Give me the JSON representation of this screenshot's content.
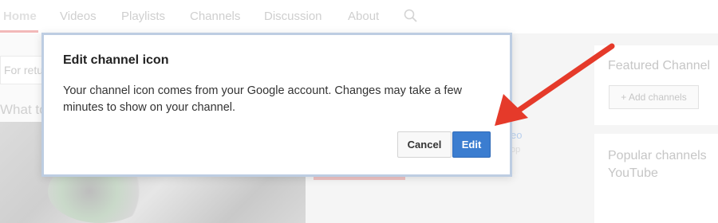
{
  "tabs": [
    {
      "label": "Home",
      "active": true
    },
    {
      "label": "Videos"
    },
    {
      "label": "Playlists"
    },
    {
      "label": "Channels"
    },
    {
      "label": "Discussion"
    },
    {
      "label": "About"
    }
  ],
  "left": {
    "input_text": "For retu",
    "heading": "What to"
  },
  "middle": {
    "link_fragment": "eo",
    "sub_fragment": "op"
  },
  "sidebar": {
    "featured_title": "Featured Channel",
    "add_channels_label": "+ Add channels",
    "popular_title_line1": "Popular channels",
    "popular_title_line2": "YouTube"
  },
  "dialog": {
    "title": "Edit channel icon",
    "body": "Your channel icon comes from your Google account. Changes may take a few minutes to show on your channel.",
    "cancel_label": "Cancel",
    "edit_label": "Edit"
  },
  "colors": {
    "edit_button": "#3b7dd0",
    "annotation_arrow": "#e53a2a",
    "dialog_border": "#bdcde2"
  }
}
